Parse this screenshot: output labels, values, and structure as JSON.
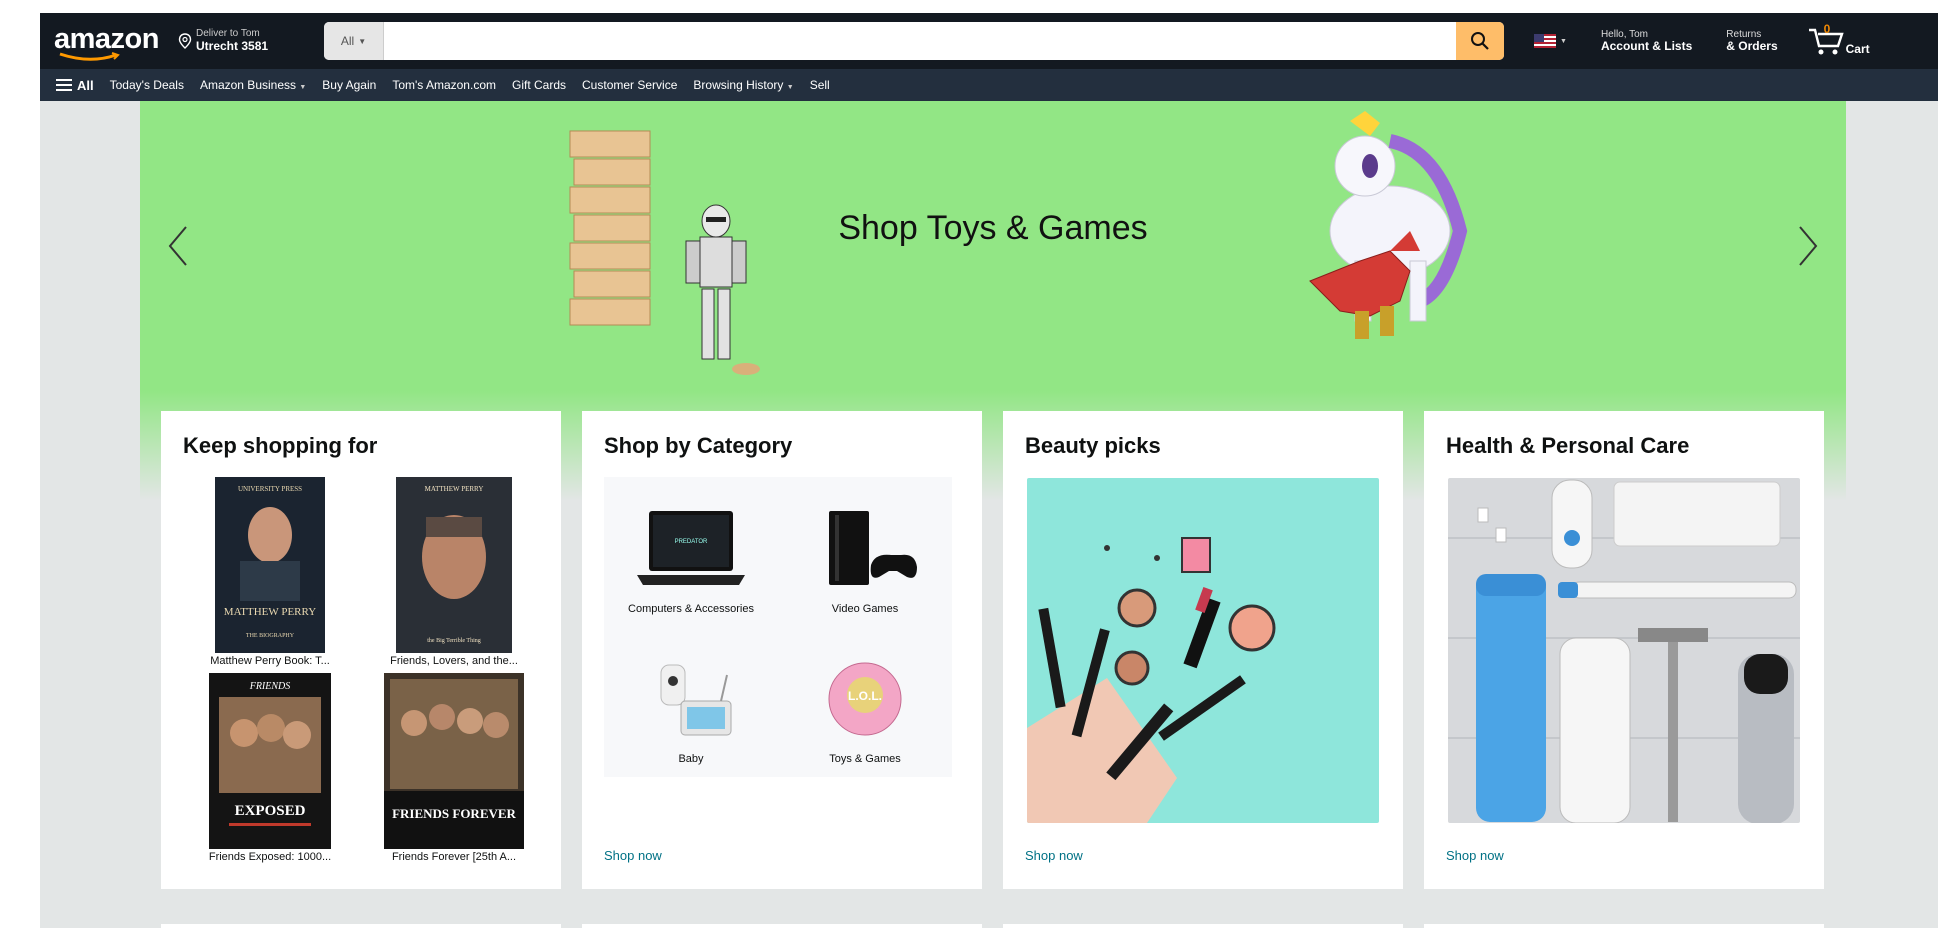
{
  "header": {
    "logo": "amazon",
    "deliver_line1": "Deliver to Tom",
    "deliver_line2": "Utrecht 3581",
    "search_category": "All",
    "search_placeholder": "",
    "account_line1": "Hello, Tom",
    "account_line2": "Account & Lists",
    "orders_line1": "Returns",
    "orders_line2": "& Orders",
    "cart_label": "Cart",
    "cart_count": "0"
  },
  "subnav": {
    "all_label": "All",
    "items": [
      "Today's Deals",
      "Amazon Business",
      "Buy Again",
      "Tom's Amazon.com",
      "Gift Cards",
      "Customer Service",
      "Browsing History",
      "Sell"
    ]
  },
  "hero": {
    "title": "Shop Toys & Games"
  },
  "cards": {
    "keep_shopping": {
      "title": "Keep shopping for",
      "books": [
        {
          "caption": "Matthew Perry Book: T...",
          "cover_top": "UNIVERSITY PRESS",
          "cover_main": "MATTHEW PERRY",
          "cover_sub": "THE BIOGRAPHY"
        },
        {
          "caption": "Friends, Lovers, and the...",
          "cover_top": "MATTHEW PERRY",
          "cover_main": "",
          "cover_sub": "the Big Terrible Thing"
        },
        {
          "caption": "Friends Exposed: 1000...",
          "cover_top": "FRIENDS",
          "cover_main": "EXPOSED",
          "cover_sub": ""
        },
        {
          "caption": "Friends Forever [25th A...",
          "cover_top": "",
          "cover_main": "FRIENDS FOREVER",
          "cover_sub": ""
        }
      ]
    },
    "shop_by_category": {
      "title": "Shop by Category",
      "items": [
        "Computers & Accessories",
        "Video Games",
        "Baby",
        "Toys & Games"
      ],
      "shop_now": "Shop now"
    },
    "beauty": {
      "title": "Beauty picks",
      "shop_now": "Shop now"
    },
    "health": {
      "title": "Health & Personal Care",
      "shop_now": "Shop now"
    }
  }
}
